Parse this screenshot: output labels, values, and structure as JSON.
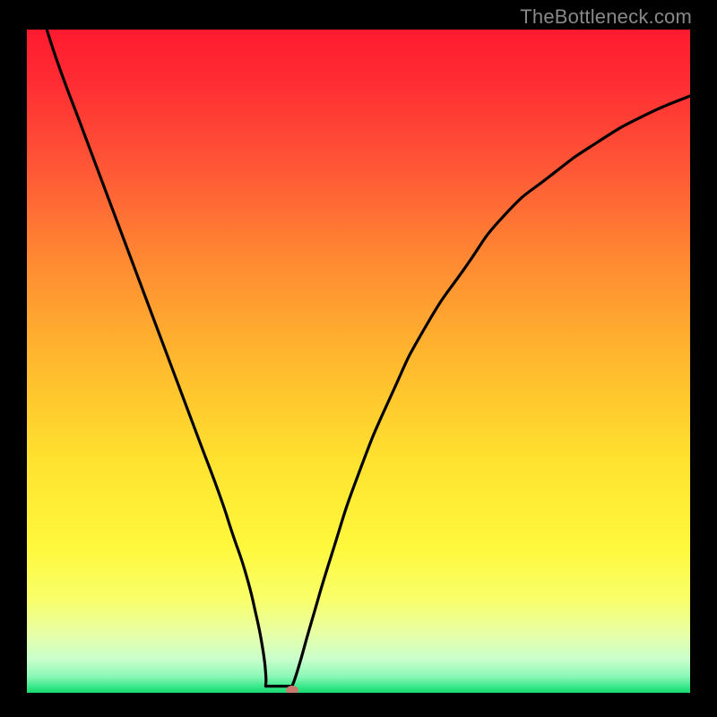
{
  "watermark": "TheBottleneck.com",
  "chart_data": {
    "type": "line",
    "title": "",
    "xlabel": "",
    "ylabel": "",
    "xlim": [
      0,
      1
    ],
    "ylim": [
      0,
      1
    ],
    "curve_left": [
      {
        "x": 0.03,
        "y": 1.0
      },
      {
        "x": 0.05,
        "y": 0.94
      },
      {
        "x": 0.08,
        "y": 0.86
      },
      {
        "x": 0.11,
        "y": 0.78
      },
      {
        "x": 0.14,
        "y": 0.7
      },
      {
        "x": 0.17,
        "y": 0.62
      },
      {
        "x": 0.2,
        "y": 0.54
      },
      {
        "x": 0.23,
        "y": 0.46
      },
      {
        "x": 0.26,
        "y": 0.38
      },
      {
        "x": 0.29,
        "y": 0.3
      },
      {
        "x": 0.31,
        "y": 0.24
      },
      {
        "x": 0.33,
        "y": 0.18
      },
      {
        "x": 0.345,
        "y": 0.12
      },
      {
        "x": 0.355,
        "y": 0.07
      },
      {
        "x": 0.36,
        "y": 0.03
      },
      {
        "x": 0.36,
        "y": 0.01
      }
    ],
    "curve_right": [
      {
        "x": 0.4,
        "y": 0.01
      },
      {
        "x": 0.41,
        "y": 0.04
      },
      {
        "x": 0.43,
        "y": 0.11
      },
      {
        "x": 0.46,
        "y": 0.21
      },
      {
        "x": 0.5,
        "y": 0.33
      },
      {
        "x": 0.55,
        "y": 0.45
      },
      {
        "x": 0.6,
        "y": 0.55
      },
      {
        "x": 0.66,
        "y": 0.64
      },
      {
        "x": 0.72,
        "y": 0.72
      },
      {
        "x": 0.79,
        "y": 0.78
      },
      {
        "x": 0.86,
        "y": 0.83
      },
      {
        "x": 0.93,
        "y": 0.87
      },
      {
        "x": 1.0,
        "y": 0.9
      }
    ],
    "bottom_flat": [
      {
        "x": 0.36,
        "y": 0.01
      },
      {
        "x": 0.4,
        "y": 0.01
      }
    ],
    "marker": {
      "x": 0.4,
      "y": 0.0
    },
    "gradient_stops": [
      {
        "offset": 0.0,
        "color": "#ff1a2f"
      },
      {
        "offset": 0.08,
        "color": "#ff2d33"
      },
      {
        "offset": 0.2,
        "color": "#ff5436"
      },
      {
        "offset": 0.35,
        "color": "#ff8a32"
      },
      {
        "offset": 0.5,
        "color": "#ffb92e"
      },
      {
        "offset": 0.65,
        "color": "#ffe22f"
      },
      {
        "offset": 0.78,
        "color": "#fff83c"
      },
      {
        "offset": 0.86,
        "color": "#f8ff6a"
      },
      {
        "offset": 0.91,
        "color": "#e8ffa6"
      },
      {
        "offset": 0.95,
        "color": "#c8ffcc"
      },
      {
        "offset": 0.975,
        "color": "#8cf7b7"
      },
      {
        "offset": 0.99,
        "color": "#3de98d"
      },
      {
        "offset": 1.0,
        "color": "#17d86f"
      }
    ],
    "marker_color": "#c77b6e",
    "curve_color": "#000000"
  }
}
